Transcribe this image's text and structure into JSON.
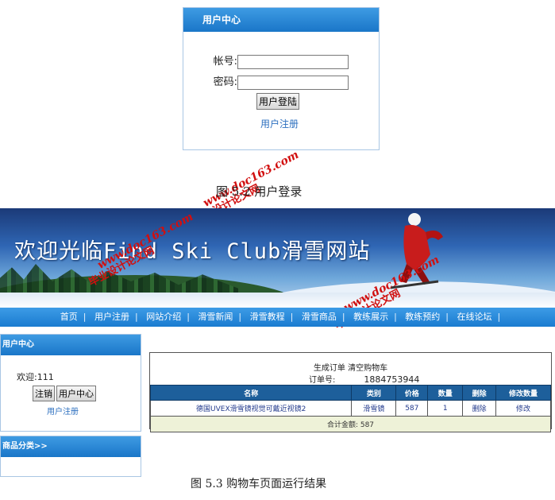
{
  "fig52": {
    "header": "用户中心",
    "account_label": "帐号:",
    "password_label": "密码:",
    "login_button": "用户登陆",
    "register_link": "用户注册",
    "caption": "图  5.2  用户登录"
  },
  "watermark": {
    "url": "www.doc163.com",
    "name": "毕业设计论文网"
  },
  "site": {
    "banner_title": "欢迎光临Find Ski Club滑雪网站",
    "nav": [
      "首页",
      "用户注册",
      "网站介绍",
      "滑雪新闻",
      "滑雪教程",
      "滑雪商品",
      "教练展示",
      "教练预约",
      "在线论坛"
    ],
    "nav_sep": "|",
    "user_center": {
      "header": "用户中心",
      "welcome": "欢迎:111",
      "logout_button": "注销",
      "center_button": "用户中心",
      "register_link": "用户注册"
    },
    "category_header": "商品分类>>",
    "cart": {
      "actions": "生成订单 清空购物车",
      "order_label": "订单号:",
      "order_no": "1884753944",
      "columns": [
        "名称",
        "类别",
        "价格",
        "数量",
        "删除",
        "修改数量"
      ],
      "rows": [
        {
          "name": "德国UVEX滑雪镜视觉可戴近视镜2",
          "category": "滑雪镜",
          "price": "587",
          "qty": "1",
          "delete": "删除",
          "edit": "修改"
        }
      ],
      "total": "合计金额:  587"
    }
  },
  "fig53_caption": "图  5.3 购物车页面运行结果"
}
